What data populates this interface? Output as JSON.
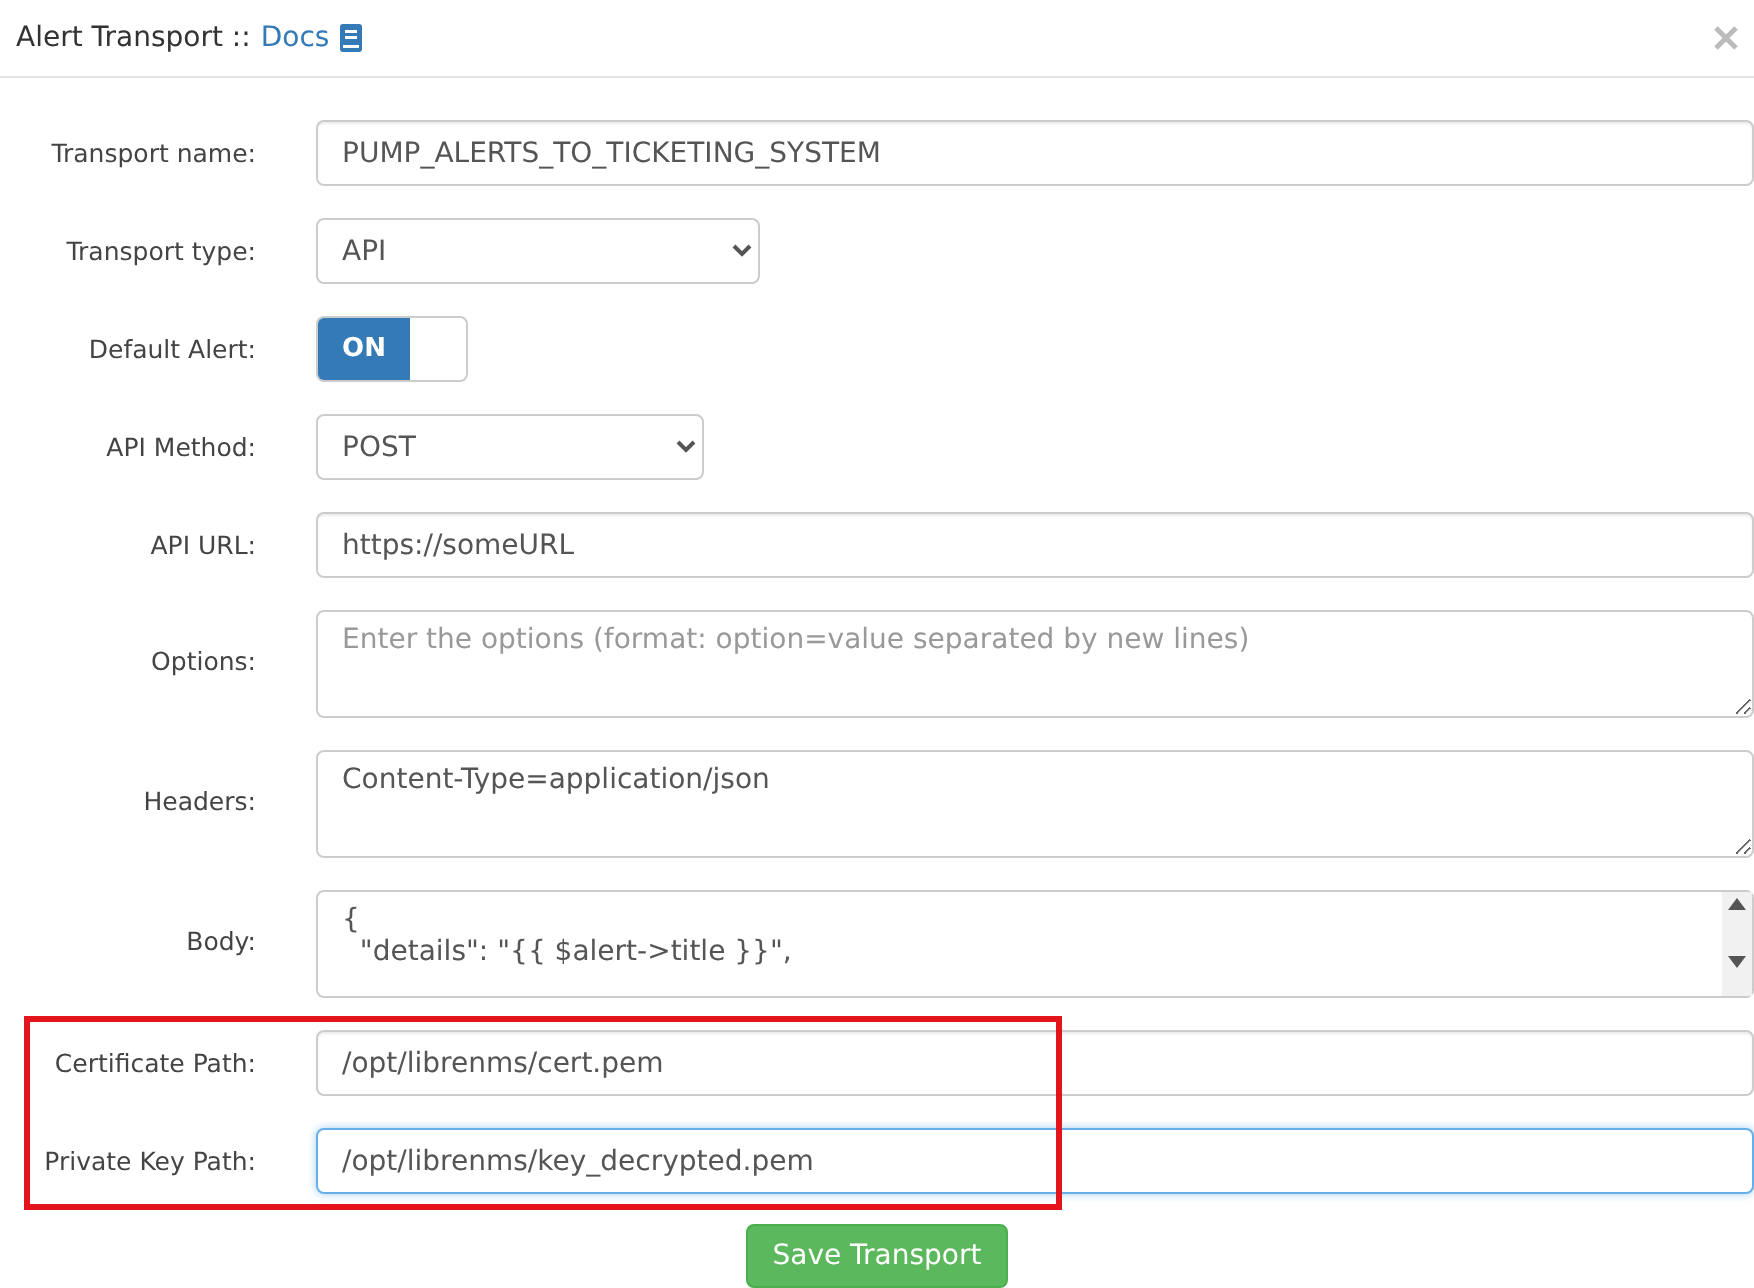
{
  "dialog": {
    "title": "Alert Transport ::",
    "docs_link": "Docs"
  },
  "fields": [
    {
      "kind": "text",
      "label": "Transport name:",
      "value": "PUMP_ALERTS_TO_TICKETING_SYSTEM",
      "focused": false
    },
    {
      "kind": "select",
      "label": "Transport type:",
      "value": "API"
    },
    {
      "kind": "toggle",
      "label": "Default Alert:",
      "on": true,
      "on_label": "ON"
    },
    {
      "kind": "select",
      "label": "API Method:",
      "value": "POST"
    },
    {
      "kind": "text",
      "label": "API URL:",
      "value": "https://someURL",
      "focused": false
    },
    {
      "kind": "textarea",
      "label": "Options:",
      "placeholder": "Enter the options (format: option=value separated by new lines)"
    },
    {
      "kind": "textarea",
      "label": "Headers:",
      "lines": [
        "Content-Type=application/json"
      ]
    },
    {
      "kind": "textarea",
      "label": "Body:",
      "lines": [
        "{",
        "  \"details\": \"{{ $alert->title }}\","
      ],
      "scrollbar": true
    }
  ],
  "highlighted_fields": [
    {
      "kind": "text",
      "label": "Certificate Path:",
      "value": "/opt/librenms/cert.pem",
      "focused": false
    },
    {
      "kind": "text",
      "label": "Private Key Path:",
      "value": "/opt/librenms/key_decrypted.pem",
      "focused": true
    }
  ],
  "save_button": "Save Transport"
}
